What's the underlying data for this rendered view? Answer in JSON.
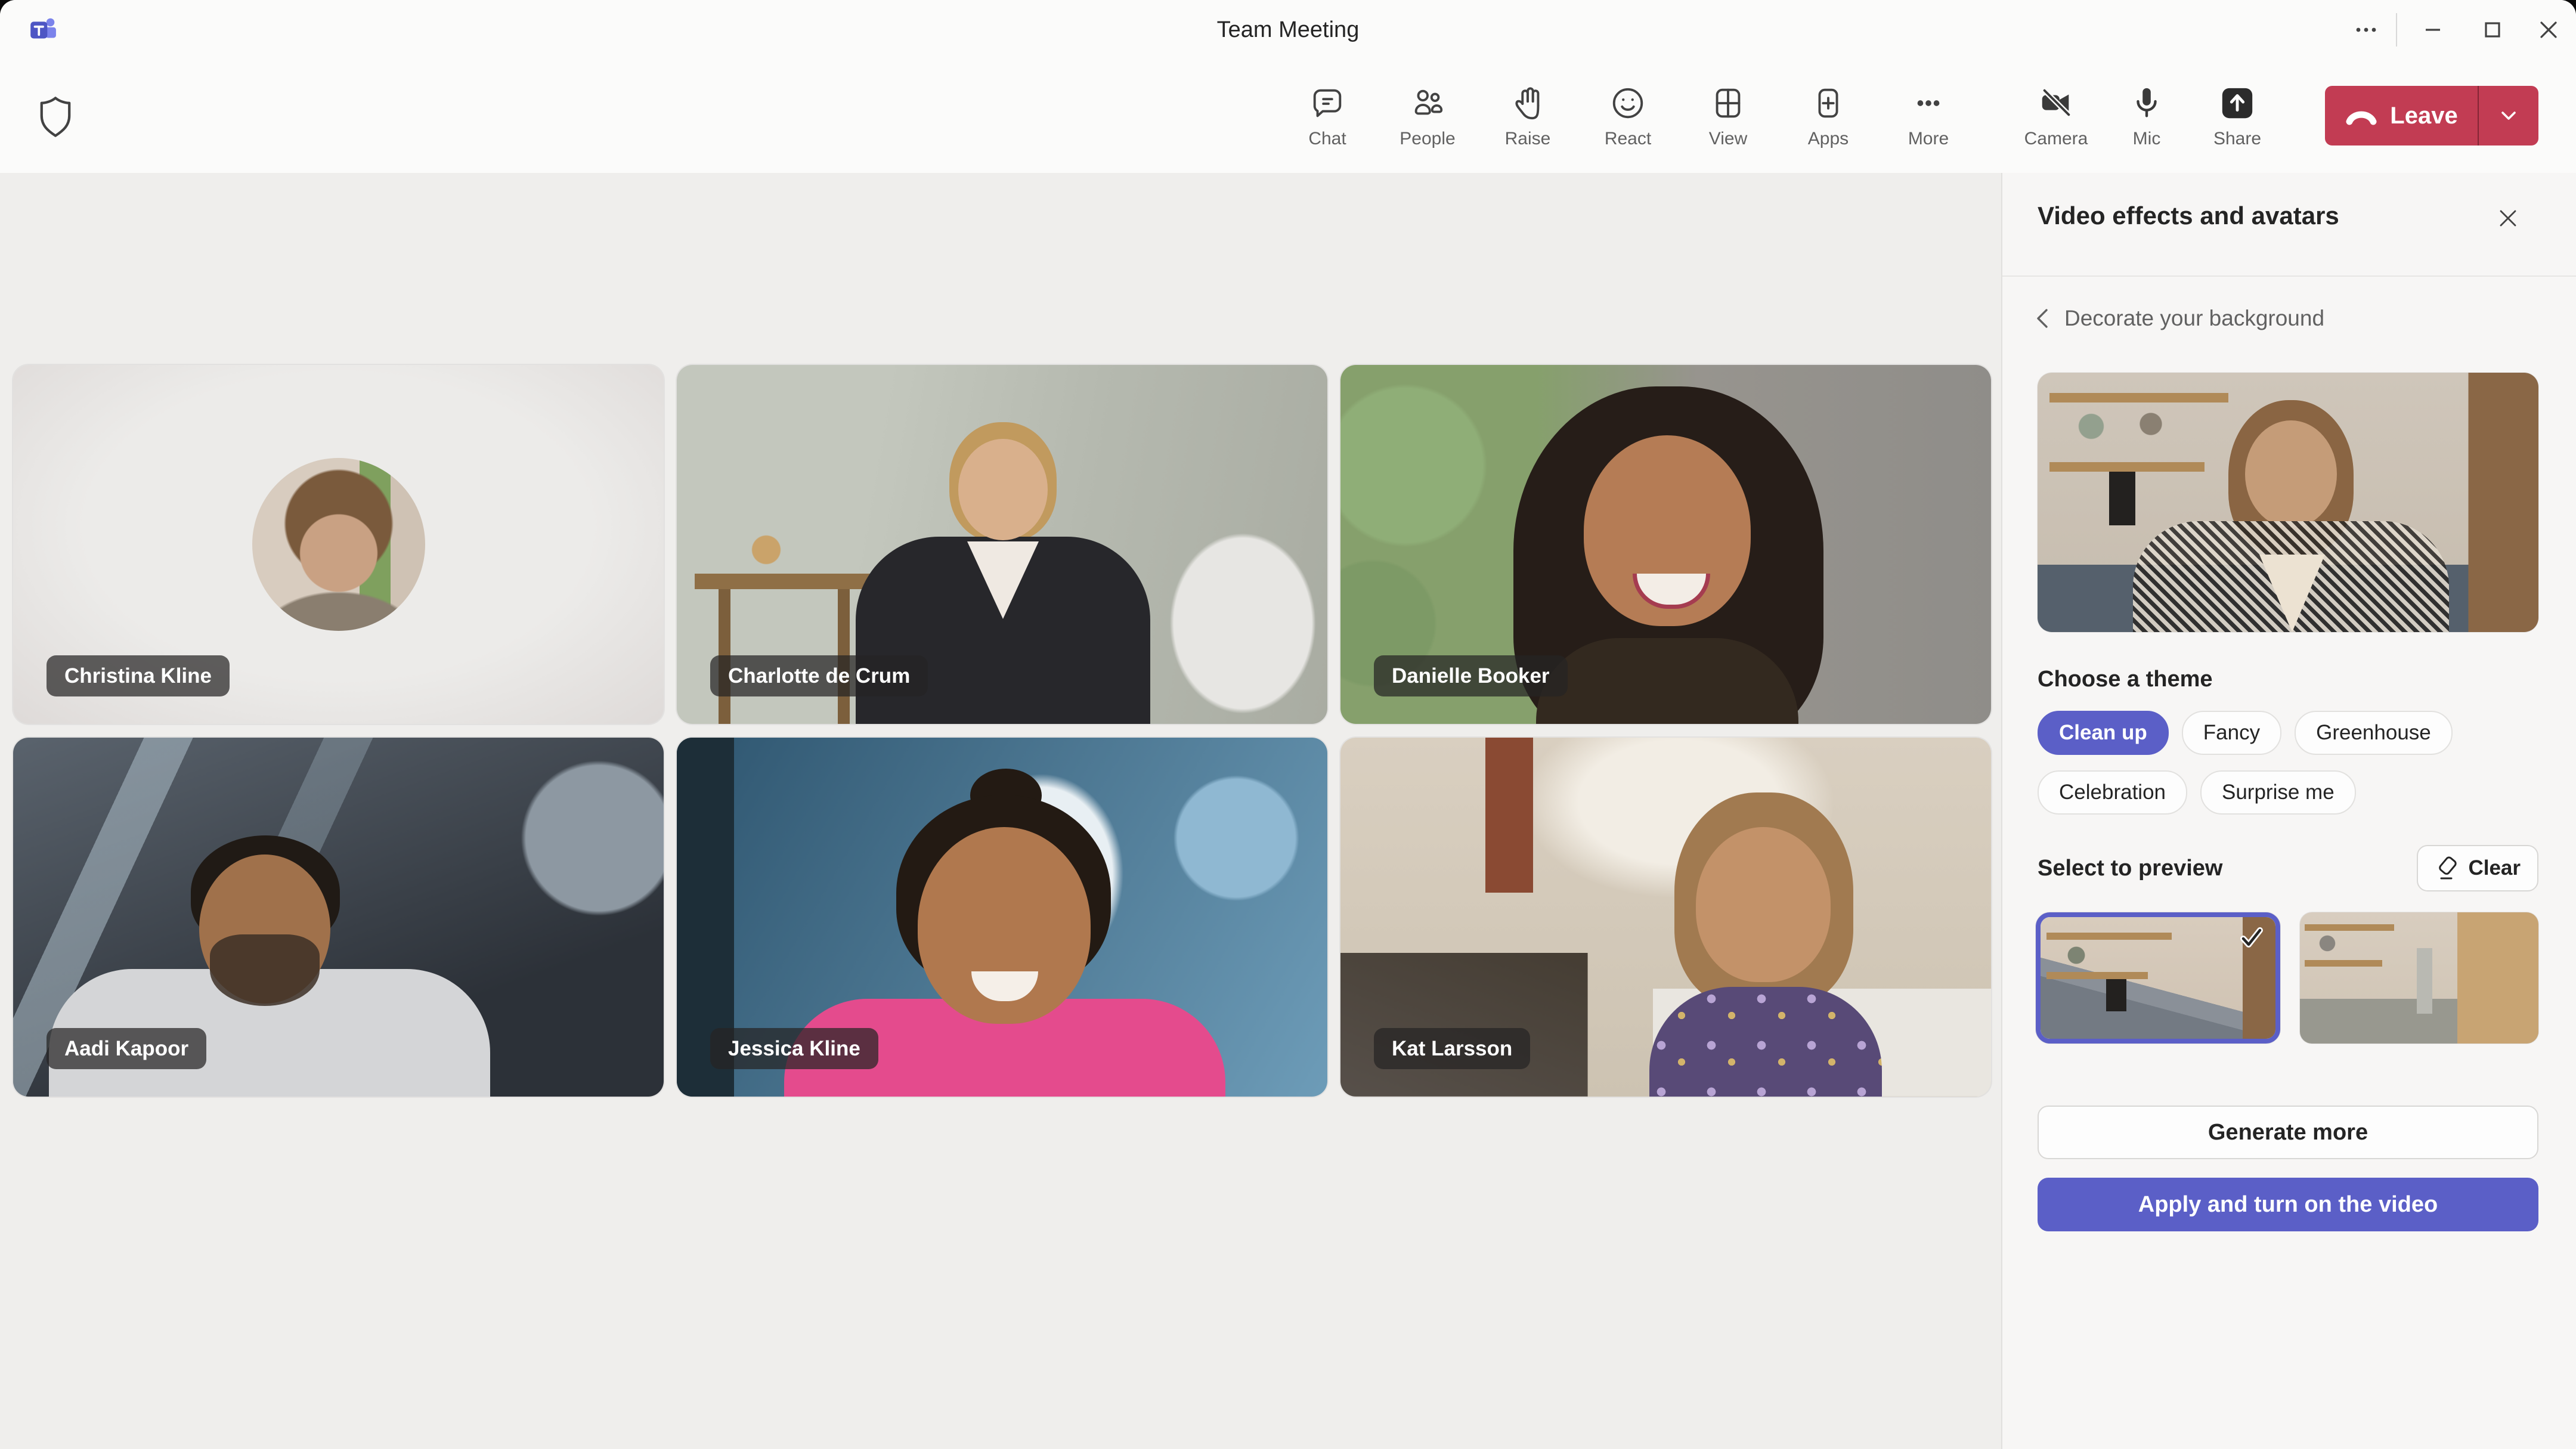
{
  "window": {
    "title": "Team Meeting",
    "controls": [
      "more-options",
      "minimize",
      "maximize",
      "close"
    ]
  },
  "toolbar": {
    "items": [
      {
        "label": "Chat",
        "icon": "chat-bubble-icon"
      },
      {
        "label": "People",
        "icon": "people-icon"
      },
      {
        "label": "Raise",
        "icon": "raised-hand-icon"
      },
      {
        "label": "React",
        "icon": "smiley-icon"
      },
      {
        "label": "View",
        "icon": "grid-view-icon"
      },
      {
        "label": "Apps",
        "icon": "apps-plus-icon"
      },
      {
        "label": "More",
        "icon": "ellipsis-icon"
      }
    ],
    "devices": [
      {
        "label": "Camera",
        "state": "off",
        "icon": "camera-off-icon"
      },
      {
        "label": "Mic",
        "state": "on",
        "icon": "microphone-icon"
      },
      {
        "label": "Share",
        "icon": "share-screen-icon"
      }
    ],
    "leave_label": "Leave",
    "shield": "meeting-security-shield"
  },
  "participants": [
    {
      "name": "Christina Kline",
      "video": "avatar-only"
    },
    {
      "name": "Charlotte de Crum",
      "video": "on"
    },
    {
      "name": "Danielle Booker",
      "video": "on"
    },
    {
      "name": "Aadi Kapoor",
      "video": "on"
    },
    {
      "name": "Jessica Kline",
      "video": "on"
    },
    {
      "name": "Kat Larsson",
      "video": "on"
    }
  ],
  "panel": {
    "title": "Video effects and avatars",
    "back_label": "Decorate your background",
    "theme": {
      "heading": "Choose a theme",
      "options": [
        {
          "label": "Clean up",
          "selected": true
        },
        {
          "label": "Fancy",
          "selected": false
        },
        {
          "label": "Greenhouse",
          "selected": false
        },
        {
          "label": "Celebration",
          "selected": false
        },
        {
          "label": "Surprise me",
          "selected": false
        }
      ]
    },
    "preview": {
      "heading": "Select to preview",
      "clear_label": "Clear",
      "thumbnails": [
        {
          "id": "generated-background-1",
          "selected": true
        },
        {
          "id": "generated-background-2",
          "selected": false
        }
      ]
    },
    "generate_label": "Generate more",
    "apply_label": "Apply and turn on the video"
  },
  "colors": {
    "accent_purple": "#5b5fc7",
    "leave_red": "#c23c53",
    "titlebar_bg": "#fbfbfa",
    "stage_bg": "#efeeec",
    "panel_bg": "#f7f6f5",
    "icon_gray": "#424242",
    "secondary_text": "#616161"
  }
}
